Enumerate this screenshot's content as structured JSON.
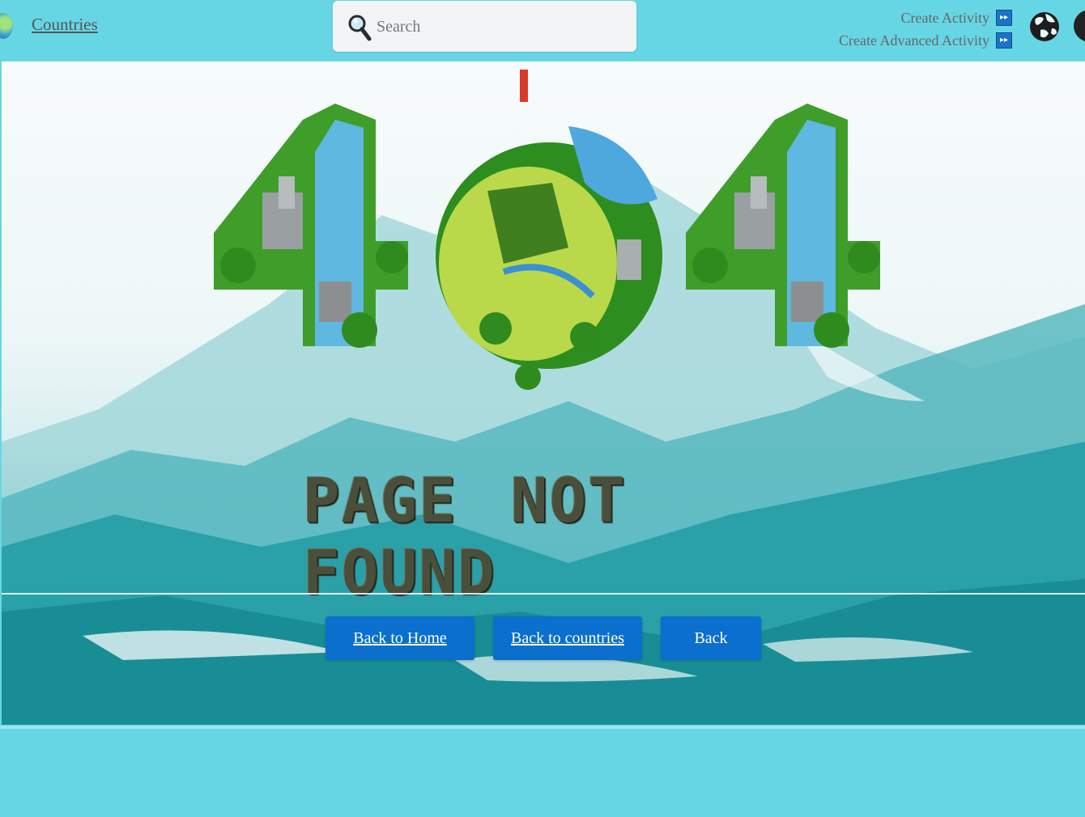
{
  "header": {
    "countries_link": "Countries",
    "search": {
      "placeholder": "Search",
      "value": ""
    },
    "create_activity_label": "Create Activity",
    "create_advanced_activity_label": "Create Advanced Activity"
  },
  "hero": {
    "error_code": "404",
    "message": "PAGE NOT FOUND"
  },
  "buttons": {
    "back_to_home": "Back to Home",
    "back_to_countries": "Back to countries",
    "back": "Back"
  },
  "colors": {
    "page_background": "#67d6e4",
    "button_background": "#0a6fcd",
    "accent_icon": "#1a73c9"
  },
  "icons": [
    "logo-globe-icon",
    "search-icon",
    "fast-forward-icon",
    "globe-icon",
    "info-icon"
  ]
}
